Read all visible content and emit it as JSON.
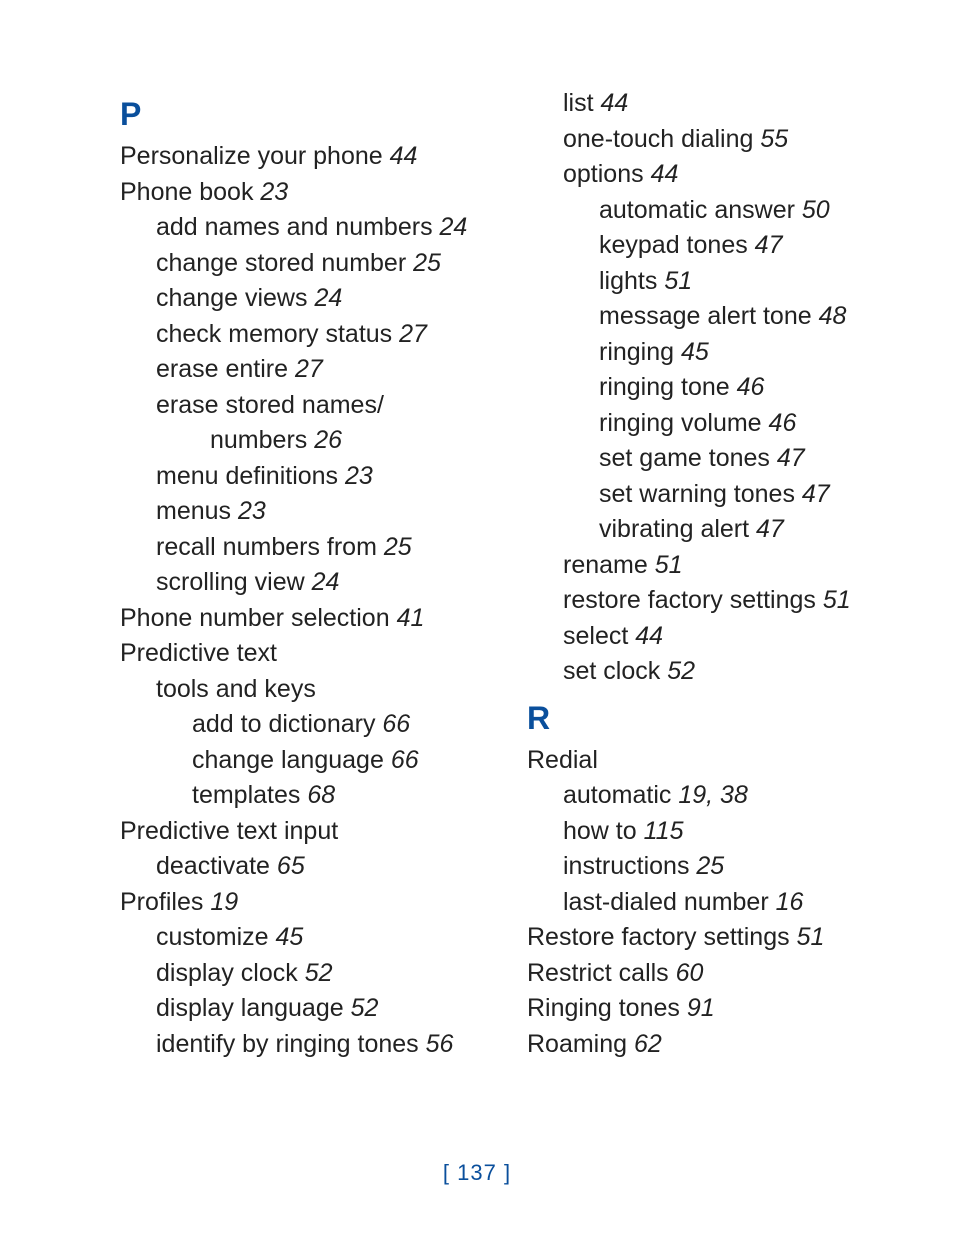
{
  "page_number": "137",
  "sections": {
    "P": {
      "letter": "P",
      "entries": [
        {
          "text": "Personalize your phone",
          "page": "44"
        },
        {
          "text": "Phone book",
          "page": "23",
          "children": [
            {
              "text": "add names and numbers",
              "page": "24"
            },
            {
              "text": "change stored number",
              "page": "25"
            },
            {
              "text": "change views",
              "page": "24"
            },
            {
              "text": "check memory status",
              "page": "27"
            },
            {
              "text": "erase entire",
              "page": "27"
            },
            {
              "text": "erase stored names/",
              "page": "",
              "cont": [
                {
                  "text": "numbers",
                  "page": "26"
                }
              ]
            },
            {
              "text": "menu definitions",
              "page": "23"
            },
            {
              "text": "menus",
              "page": "23"
            },
            {
              "text": "recall numbers from",
              "page": "25"
            },
            {
              "text": "scrolling view",
              "page": "24"
            }
          ]
        },
        {
          "text": "Phone number selection",
          "page": "41"
        },
        {
          "text": "Predictive text",
          "page": "",
          "children": [
            {
              "text": "tools and keys",
              "page": "",
              "children": [
                {
                  "text": "add to dictionary",
                  "page": "66"
                },
                {
                  "text": "change language",
                  "page": "66"
                },
                {
                  "text": "templates",
                  "page": "68"
                }
              ]
            }
          ]
        },
        {
          "text": "Predictive text input",
          "page": "",
          "children": [
            {
              "text": "deactivate",
              "page": "65"
            }
          ]
        },
        {
          "text": "Profiles",
          "page": "19",
          "children": [
            {
              "text": "customize",
              "page": "45"
            },
            {
              "text": "display clock",
              "page": "52"
            },
            {
              "text": "display language",
              "page": "52"
            },
            {
              "text": "identify by ringing tones",
              "page": "56"
            },
            {
              "text": "list",
              "page": "44"
            },
            {
              "text": "one-touch dialing",
              "page": "55"
            },
            {
              "text": "options",
              "page": "44",
              "children": [
                {
                  "text": "automatic answer",
                  "page": "50"
                },
                {
                  "text": "keypad tones",
                  "page": "47"
                },
                {
                  "text": "lights",
                  "page": "51"
                },
                {
                  "text": "message alert tone",
                  "page": "48"
                },
                {
                  "text": "ringing",
                  "page": "45"
                },
                {
                  "text": "ringing tone",
                  "page": "46"
                },
                {
                  "text": "ringing volume",
                  "page": "46"
                },
                {
                  "text": "set game tones",
                  "page": "47"
                },
                {
                  "text": "set warning tones",
                  "page": "47"
                },
                {
                  "text": "vibrating alert",
                  "page": "47"
                }
              ]
            },
            {
              "text": "rename",
              "page": "51"
            },
            {
              "text": "restore factory settings",
              "page": "51"
            },
            {
              "text": "select",
              "page": "44"
            },
            {
              "text": "set clock",
              "page": "52"
            }
          ]
        }
      ]
    },
    "R": {
      "letter": "R",
      "entries": [
        {
          "text": "Redial",
          "page": "",
          "children": [
            {
              "text": "automatic",
              "page": "19, 38"
            },
            {
              "text": "how to",
              "page": "115"
            },
            {
              "text": "instructions",
              "page": "25"
            },
            {
              "text": "last-dialed number",
              "page": "16"
            }
          ]
        },
        {
          "text": "Restore factory settings",
          "page": "51"
        },
        {
          "text": "Restrict calls",
          "page": "60"
        },
        {
          "text": "Ringing tones",
          "page": "91"
        },
        {
          "text": "Roaming",
          "page": "62"
        }
      ]
    }
  }
}
